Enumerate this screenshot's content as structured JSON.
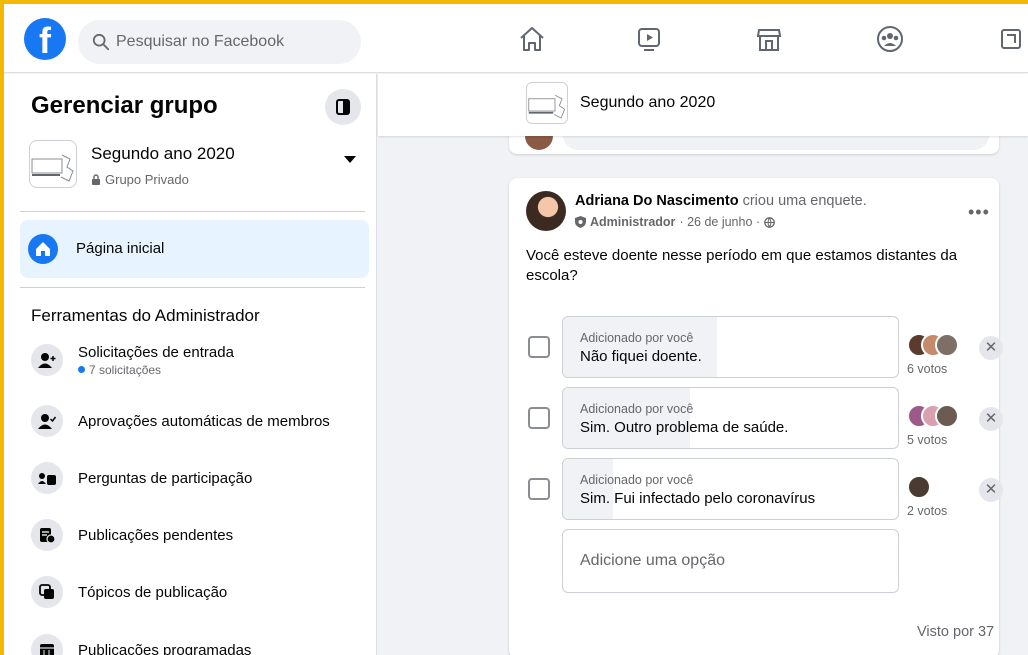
{
  "colors": {
    "brand": "#1877f2",
    "frame": "#f5b800",
    "muted": "#65676b"
  },
  "topbar": {
    "logo_letter": "f",
    "search_placeholder": "Pesquisar no Facebook",
    "nav_icons": [
      "home-icon",
      "watch-icon",
      "marketplace-icon",
      "groups-icon",
      "gaming-icon"
    ]
  },
  "sidebar": {
    "title": "Gerenciar grupo",
    "group": {
      "name": "Segundo ano 2020",
      "type": "Grupo Privado"
    },
    "home_label": "Página inicial",
    "admin_tools_title": "Ferramentas do Administrador",
    "items": [
      {
        "label": "Solicitações de entrada",
        "sub": "7 solicitações",
        "icon": "person-add-icon"
      },
      {
        "label": "Aprovações automáticas de membros",
        "icon": "person-check-icon"
      },
      {
        "label": "Perguntas de participação",
        "icon": "member-questions-icon"
      },
      {
        "label": "Publicações pendentes",
        "icon": "pending-posts-icon"
      },
      {
        "label": "Tópicos de publicação",
        "icon": "topics-icon"
      },
      {
        "label": "Publicações programadas",
        "icon": "calendar-icon"
      }
    ]
  },
  "main": {
    "header_title": "Segundo ano 2020",
    "post": {
      "author": "Adriana Do Nascimento",
      "action": " criou uma enquete.",
      "role": "Administrador",
      "date": "· 26 de junho ·",
      "question": "Você esteve doente nesse período em que estamos distantes da escola?",
      "options": [
        {
          "added_by": "Adicionado por você",
          "label": "Não fiquei doente.",
          "votes": "6 votos",
          "share": 0.46
        },
        {
          "added_by": "Adicionado por você",
          "label": "Sim. Outro problema de saúde.",
          "votes": "5 votos",
          "share": 0.38
        },
        {
          "added_by": "Adicionado por você",
          "label": "Sim. Fui infectado pelo coronavírus",
          "votes": "2 votos",
          "share": 0.15
        }
      ],
      "add_option_placeholder": "Adicione uma opção",
      "seen_by": "Visto por 37"
    }
  }
}
